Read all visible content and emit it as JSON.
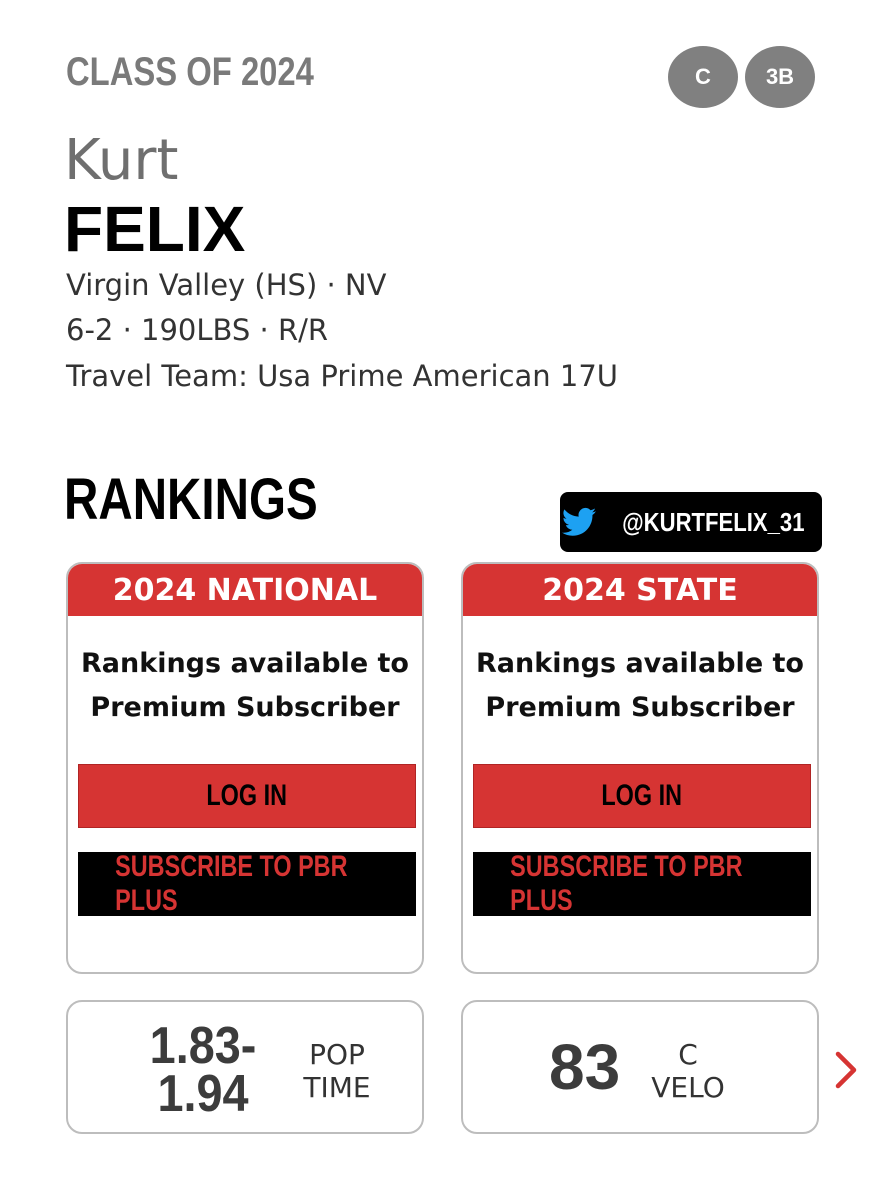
{
  "header": {
    "class_of": "CLASS OF 2024",
    "positions": [
      "C",
      "3B"
    ]
  },
  "player": {
    "first_name": "Kurt",
    "last_name": "FELIX",
    "school": "Virgin Valley (HS) · NV",
    "measurables": "6-2 · 190LBS · R/R",
    "travel_team": "Travel Team: Usa Prime American 17U"
  },
  "rankings": {
    "heading": "RANKINGS",
    "twitter_handle": "@KURTFELIX_31",
    "cards": [
      {
        "title": "2024 NATIONAL",
        "message_line1": "Rankings available to",
        "message_line2": "Premium Subscriber",
        "login_label": "LOG IN",
        "subscribe_label": "SUBSCRIBE TO PBR PLUS"
      },
      {
        "title": "2024 STATE",
        "message_line1": "Rankings available to",
        "message_line2": "Premium Subscriber",
        "login_label": "LOG IN",
        "subscribe_label": "SUBSCRIBE TO PBR PLUS"
      }
    ]
  },
  "stats": [
    {
      "value_line1": "1.83-",
      "value_line2": "1.94",
      "label_line1": "POP",
      "label_line2": "TIME"
    },
    {
      "value": "83",
      "label_line1": "C",
      "label_line2": "VELO"
    }
  ],
  "colors": {
    "accent_red": "#d63433",
    "twitter_blue": "#1da1f2",
    "badge_gray": "#808080"
  },
  "icons": {
    "twitter": "twitter-bird-icon",
    "next": "chevron-right-icon"
  }
}
